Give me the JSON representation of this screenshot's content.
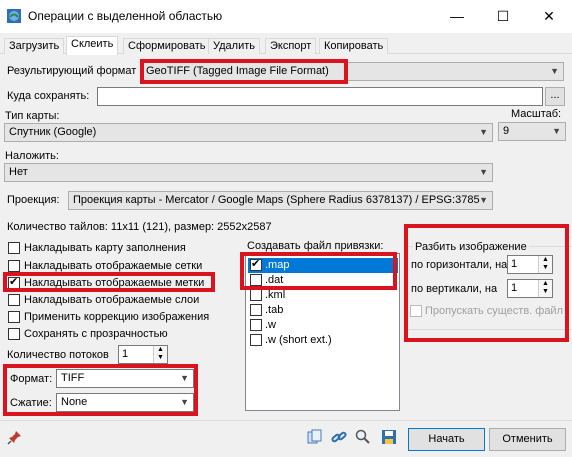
{
  "window": {
    "title": "Операции с выделенной областью",
    "minimize": "—",
    "maximize": "☐",
    "close": "✕"
  },
  "tabs": [
    {
      "label": "Загрузить"
    },
    {
      "label": "Склеить"
    },
    {
      "label": "Сформировать"
    },
    {
      "label": "Удалить"
    },
    {
      "label": "Экспорт"
    },
    {
      "label": "Копировать"
    }
  ],
  "form": {
    "result_format_label": "Результирующий формат",
    "result_format_value": "GeoTIFF (Tagged Image File Format)",
    "save_to_label": "Куда сохранять:",
    "save_to_value": "",
    "browse_label": "...",
    "map_type_label": "Тип карты:",
    "map_type_value": "Спутник (Google)",
    "zoom_label": "Масштаб:",
    "zoom_value": "9",
    "overlay_label": "Наложить:",
    "overlay_value": "Нет",
    "projection_label": "Проекция:",
    "projection_value": "Проекция карты - Mercator / Google Maps (Sphere Radius 6378137) / EPSG:3785",
    "tiles_info": "Количество тайлов: 11x11 (121), размер: 2552x2587"
  },
  "options": [
    {
      "label": "Накладывать карту заполнения",
      "checked": false
    },
    {
      "label": "Накладывать отображаемые сетки",
      "checked": false
    },
    {
      "label": "Накладывать отображаемые метки",
      "checked": true
    },
    {
      "label": "Накладывать отображаемые слои",
      "checked": false
    },
    {
      "label": "Применить коррекцию изображения",
      "checked": false
    },
    {
      "label": "Сохранять с прозрачностью",
      "checked": false
    }
  ],
  "threads": {
    "label": "Количество потоков",
    "value": "1"
  },
  "format": {
    "label": "Формат:",
    "value": "TIFF"
  },
  "compression": {
    "label": "Сжатие:",
    "value": "None"
  },
  "world_file": {
    "label": "Создавать файл привязки:",
    "items": [
      {
        "label": ".map",
        "checked": true,
        "selected": true
      },
      {
        "label": ".dat",
        "checked": false
      },
      {
        "label": ".kml",
        "checked": false
      },
      {
        "label": ".tab",
        "checked": false
      },
      {
        "label": ".w",
        "checked": false
      },
      {
        "label": ".w (short ext.)",
        "checked": false
      }
    ]
  },
  "split": {
    "title": "Разбить изображение",
    "horizontal_label": "по горизонтали, на",
    "horizontal_value": "1",
    "vertical_label": "по вертикали, на",
    "vertical_value": "1",
    "skip_label": "Пропускать существ. файл"
  },
  "footer": {
    "start_label": "Начать",
    "cancel_label": "Отменить"
  },
  "colors": {
    "highlight": "#d9141e",
    "selection": "#0078d7"
  }
}
